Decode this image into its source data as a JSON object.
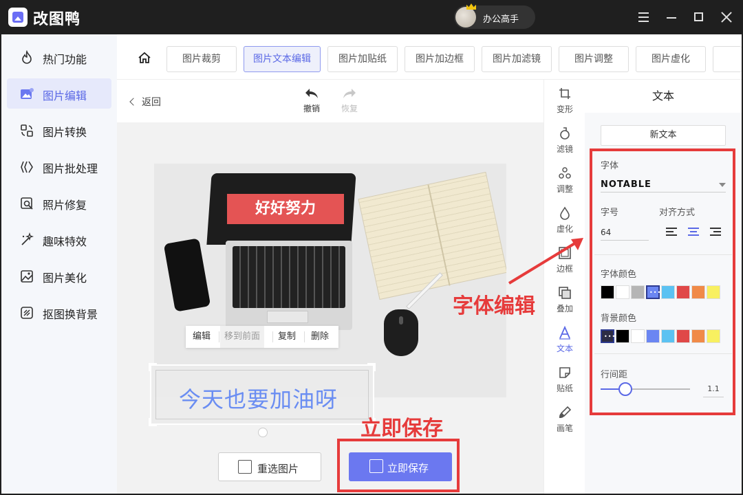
{
  "app": {
    "title": "改图鸭",
    "user_name": "办公高手"
  },
  "sidebar": {
    "items": [
      {
        "label": "热门功能",
        "icon": "fire-icon"
      },
      {
        "label": "图片编辑",
        "icon": "image-edit-icon",
        "active": true
      },
      {
        "label": "图片转换",
        "icon": "convert-icon"
      },
      {
        "label": "图片批处理",
        "icon": "batch-icon"
      },
      {
        "label": "照片修复",
        "icon": "photo-repair-icon"
      },
      {
        "label": "趣味特效",
        "icon": "magic-wand-icon"
      },
      {
        "label": "图片美化",
        "icon": "beautify-icon"
      },
      {
        "label": "抠图换背景",
        "icon": "cutout-icon"
      }
    ]
  },
  "tabs": [
    {
      "label": "图片裁剪"
    },
    {
      "label": "图片文本编辑",
      "active": true
    },
    {
      "label": "图片加贴纸"
    },
    {
      "label": "图片加边框"
    },
    {
      "label": "图片加滤镜"
    },
    {
      "label": "图片调整"
    },
    {
      "label": "图片虚化"
    }
  ],
  "canvas": {
    "back_label": "返回",
    "undo_label": "撤销",
    "redo_label": "恢复",
    "photo_banner_text": "好好努力",
    "context_menu": {
      "edit": "编辑",
      "bring_front": "移到前面",
      "copy": "复制",
      "delete": "删除"
    },
    "text_layer": "今天也要加油呀",
    "reselect_label": "重选图片",
    "save_label": "立即保存"
  },
  "tools": [
    {
      "label": "变形",
      "icon": "crop-icon"
    },
    {
      "label": "滤镜",
      "icon": "filter-icon"
    },
    {
      "label": "调整",
      "icon": "adjust-icon"
    },
    {
      "label": "虚化",
      "icon": "blur-drop-icon"
    },
    {
      "label": "边框",
      "icon": "border-icon"
    },
    {
      "label": "叠加",
      "icon": "overlay-icon"
    },
    {
      "label": "文本",
      "icon": "text-icon",
      "active": true
    },
    {
      "label": "贴纸",
      "icon": "sticker-icon"
    },
    {
      "label": "画笔",
      "icon": "brush-icon"
    }
  ],
  "panel": {
    "title": "文本",
    "new_text_label": "新文本",
    "font_label": "字体",
    "font_value": "NOTABLE",
    "size_label": "字号",
    "size_value": "64",
    "align_label": "对齐方式",
    "align_selected": "center",
    "font_color_label": "字体颜色",
    "font_colors": [
      "#000000",
      "#ffffff",
      "#b5b5b5",
      "#6b86f2",
      "#5bc2f2",
      "#e04848",
      "#f08a48",
      "#f8f060"
    ],
    "font_color_selected": 3,
    "bg_color_label": "背景颜色",
    "bg_colors": [
      "#2d2d44",
      "#000000",
      "#ffffff",
      "#6b86f2",
      "#5bc2f2",
      "#e04848",
      "#f08a48",
      "#f8f060"
    ],
    "bg_color_selected": 0,
    "line_spacing_label": "行间距",
    "line_spacing_value": "1.1",
    "line_spacing_fraction": 0.28
  },
  "annotations": {
    "font_edit_text": "字体编辑",
    "save_text": "立即保存",
    "color": "#e63b3b"
  }
}
